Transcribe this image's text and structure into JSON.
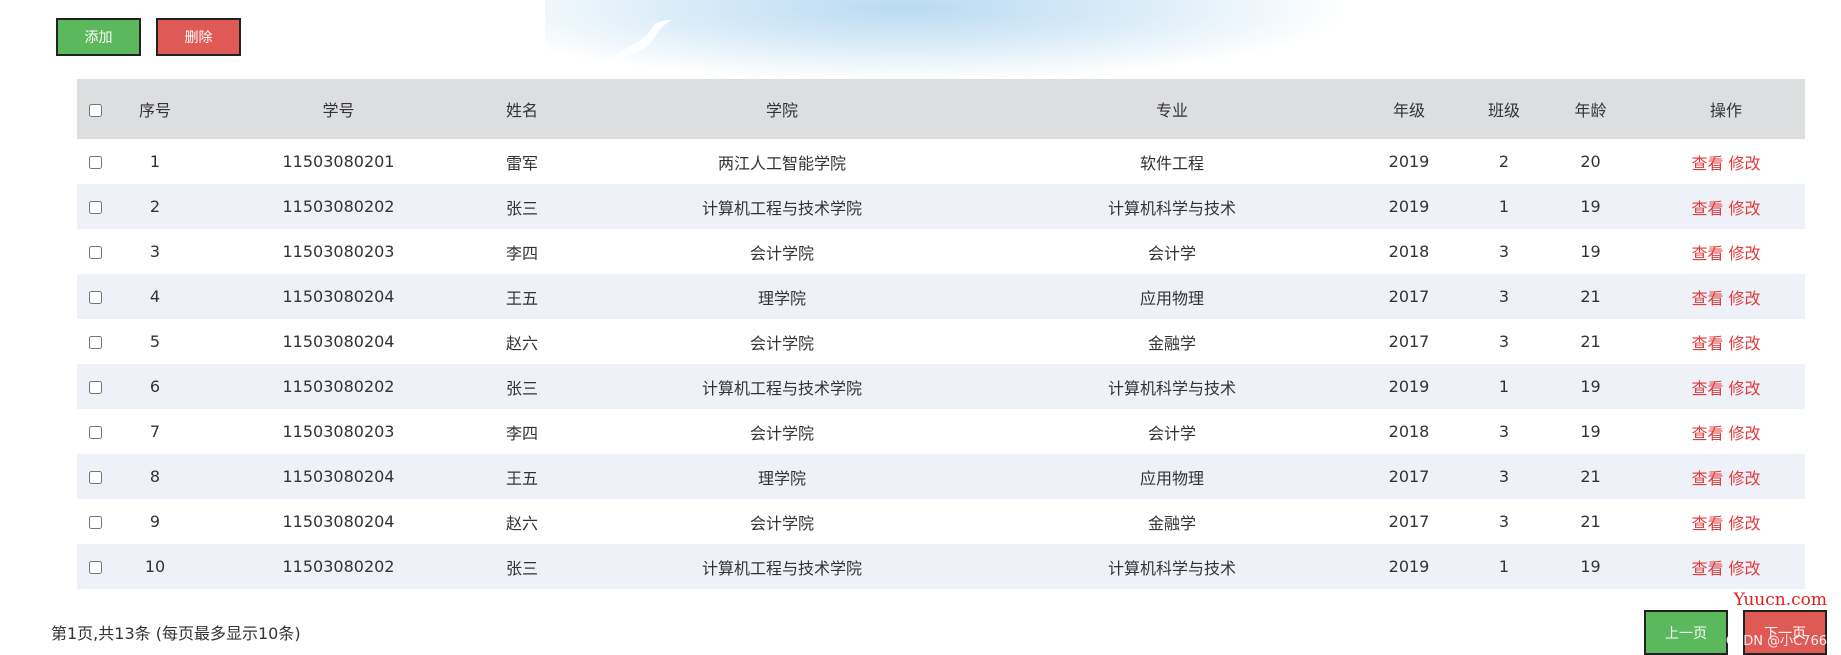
{
  "toolbar": {
    "add_label": "添加",
    "delete_label": "删除"
  },
  "table": {
    "headers": [
      "序号",
      "学号",
      "姓名",
      "学院",
      "专业",
      "年级",
      "班级",
      "年龄",
      "操作"
    ],
    "view_label": "查看",
    "edit_label": "修改",
    "rows": [
      {
        "no": "1",
        "sid": "11503080201",
        "name": "雷军",
        "college": "两江人工智能学院",
        "major": "软件工程",
        "grade": "2019",
        "cls": "2",
        "age": "20"
      },
      {
        "no": "2",
        "sid": "11503080202",
        "name": "张三",
        "college": "计算机工程与技术学院",
        "major": "计算机科学与技术",
        "grade": "2019",
        "cls": "1",
        "age": "19"
      },
      {
        "no": "3",
        "sid": "11503080203",
        "name": "李四",
        "college": "会计学院",
        "major": "会计学",
        "grade": "2018",
        "cls": "3",
        "age": "19"
      },
      {
        "no": "4",
        "sid": "11503080204",
        "name": "王五",
        "college": "理学院",
        "major": "应用物理",
        "grade": "2017",
        "cls": "3",
        "age": "21"
      },
      {
        "no": "5",
        "sid": "11503080204",
        "name": "赵六",
        "college": "会计学院",
        "major": "金融学",
        "grade": "2017",
        "cls": "3",
        "age": "21"
      },
      {
        "no": "6",
        "sid": "11503080202",
        "name": "张三",
        "college": "计算机工程与技术学院",
        "major": "计算机科学与技术",
        "grade": "2019",
        "cls": "1",
        "age": "19"
      },
      {
        "no": "7",
        "sid": "11503080203",
        "name": "李四",
        "college": "会计学院",
        "major": "会计学",
        "grade": "2018",
        "cls": "3",
        "age": "19"
      },
      {
        "no": "8",
        "sid": "11503080204",
        "name": "王五",
        "college": "理学院",
        "major": "应用物理",
        "grade": "2017",
        "cls": "3",
        "age": "21"
      },
      {
        "no": "9",
        "sid": "11503080204",
        "name": "赵六",
        "college": "会计学院",
        "major": "金融学",
        "grade": "2017",
        "cls": "3",
        "age": "21"
      },
      {
        "no": "10",
        "sid": "11503080202",
        "name": "张三",
        "college": "计算机工程与技术学院",
        "major": "计算机科学与技术",
        "grade": "2019",
        "cls": "1",
        "age": "19"
      }
    ]
  },
  "pager": {
    "info": "第1页,共13条 (每页最多显示10条)",
    "prev_label": "上一页",
    "next_label": "下一页"
  },
  "watermark": {
    "site": "Yuucn.com",
    "csdn": "CSDN @小C766"
  },
  "colors": {
    "green": "#5cb85c",
    "red": "#e05a55",
    "link": "#e23b3b",
    "header_bg": "#dcdee0",
    "stripe": "#eef1f8"
  }
}
